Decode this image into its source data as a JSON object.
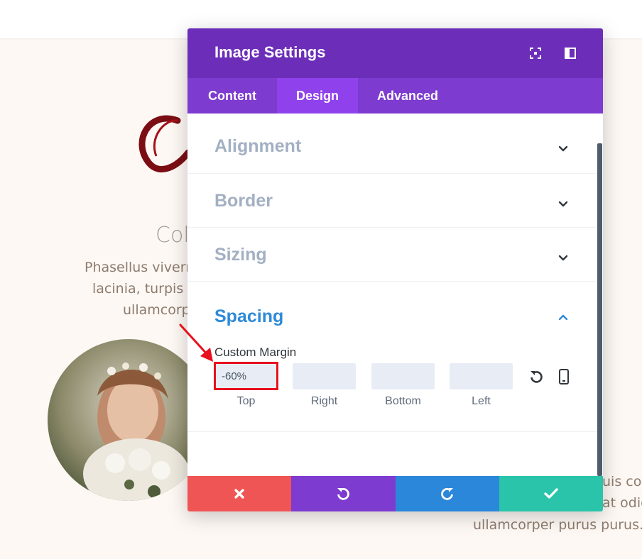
{
  "background": {
    "heading": "Col",
    "paragraph_left": [
      "Phasellus viverra",
      "lacinia, turpis p",
      "ullamcorp"
    ],
    "paragraph_right": [
      "uis cor",
      "at odio",
      "ullamcorper purus purus."
    ]
  },
  "modal": {
    "title": "Image Settings",
    "header_icons": [
      "expand-icon",
      "split-view-icon"
    ],
    "tabs": [
      {
        "label": "Content",
        "active": false
      },
      {
        "label": "Design",
        "active": true
      },
      {
        "label": "Advanced",
        "active": false
      }
    ],
    "sections": [
      {
        "title": "Alignment",
        "expanded": false
      },
      {
        "title": "Border",
        "expanded": false
      },
      {
        "title": "Sizing",
        "expanded": false
      },
      {
        "title": "Spacing",
        "expanded": true
      }
    ],
    "spacing": {
      "custom_margin_label": "Custom Margin",
      "fields": [
        {
          "label": "Top",
          "value": "-60%"
        },
        {
          "label": "Right",
          "value": ""
        },
        {
          "label": "Bottom",
          "value": ""
        },
        {
          "label": "Left",
          "value": ""
        }
      ],
      "icons": [
        "reset-icon",
        "mobile-device-icon"
      ]
    },
    "footer_buttons": [
      "discard-icon",
      "undo-icon",
      "redo-icon",
      "save-checkmark-icon"
    ]
  },
  "colors": {
    "header": "#6c2eb9",
    "tabs": "#7e3bd0",
    "active_tab": "#8f42ec",
    "section_title": "#a3b0c3",
    "expanded_title": "#2e8ad8",
    "discard": "#ef5555",
    "undo": "#7d3bcf",
    "redo": "#2b87da",
    "save": "#29c4a9",
    "annotation": "#e8101d"
  }
}
